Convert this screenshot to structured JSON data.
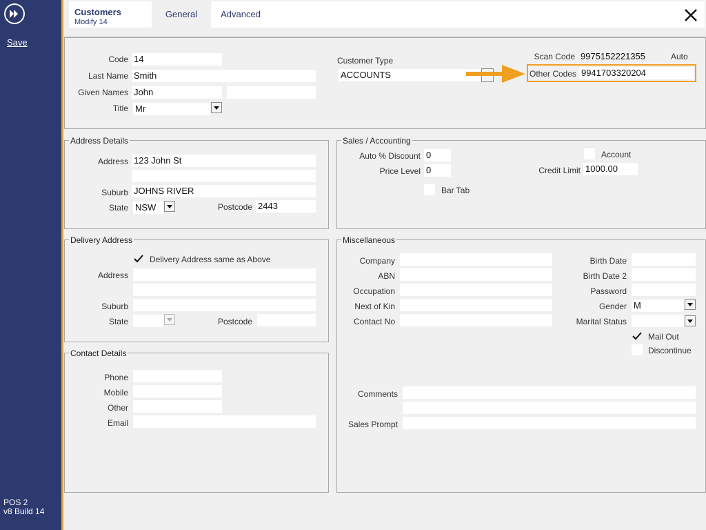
{
  "sidebar": {
    "save_label": "Save",
    "version_line1": "POS 2",
    "version_line2": "v8 Build 14"
  },
  "header": {
    "title": "Customers",
    "subtitle": "Modify 14",
    "tabs": [
      {
        "label": "General"
      },
      {
        "label": "Advanced"
      }
    ]
  },
  "main": {
    "code_label": "Code",
    "code_value": "14",
    "last_name_label": "Last Name",
    "last_name_value": "Smith",
    "given_names_label": "Given Names",
    "given_names_value": "John",
    "given_names_value2": "",
    "title_label": "Title",
    "title_value": "Mr",
    "customer_type_label": "Customer Type",
    "customer_type_value": "ACCOUNTS",
    "scan_code_label": "Scan Code",
    "scan_code_value": "9975152221355",
    "scan_code_auto": "Auto",
    "other_codes_label": "Other Codes",
    "other_codes_value": "9941703320204"
  },
  "address": {
    "legend": "Address Details",
    "address_label": "Address",
    "address_line1": "123 John St",
    "address_line2": "",
    "suburb_label": "Suburb",
    "suburb_value": "JOHNS RIVER",
    "state_label": "State",
    "state_value": "NSW",
    "postcode_label": "Postcode",
    "postcode_value": "2443"
  },
  "sales": {
    "legend": "Sales / Accounting",
    "auto_discount_label": "Auto % Discount",
    "auto_discount_value": "0",
    "price_level_label": "Price Level",
    "price_level_value": "0",
    "bar_tab_label": "Bar Tab",
    "account_label": "Account",
    "credit_limit_label": "Credit Limit",
    "credit_limit_value": "1000.00"
  },
  "delivery": {
    "legend": "Delivery Address",
    "same_label": "Delivery Address same as Above",
    "address_label": "Address",
    "suburb_label": "Suburb",
    "state_label": "State",
    "postcode_label": "Postcode"
  },
  "contact": {
    "legend": "Contact Details",
    "phone_label": "Phone",
    "mobile_label": "Mobile",
    "other_label": "Other",
    "email_label": "Email"
  },
  "misc": {
    "legend": "Miscellaneous",
    "company_label": "Company",
    "abn_label": "ABN",
    "occupation_label": "Occupation",
    "next_of_kin_label": "Next of Kin",
    "contact_no_label": "Contact No",
    "birth_date_label": "Birth Date",
    "birth_date2_label": "Birth Date 2",
    "password_label": "Password",
    "gender_label": "Gender",
    "gender_value": "M",
    "marital_status_label": "Marital Status",
    "marital_status_value": "",
    "mail_out_label": "Mail Out",
    "discontinue_label": "Discontinue",
    "comments_label": "Comments",
    "sales_prompt_label": "Sales Prompt"
  },
  "colors": {
    "sidebar": "#2c3a6f",
    "accent": "#e8a33a",
    "highlight": "#f0a020"
  }
}
